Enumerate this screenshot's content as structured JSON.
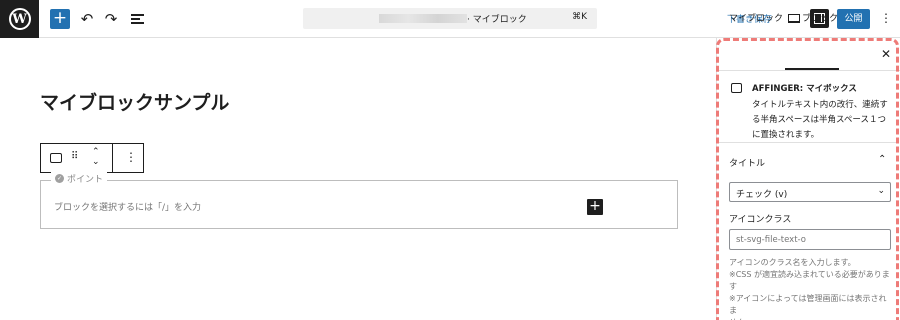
{
  "toolbar": {
    "logo": "W",
    "logo_icon": "wordpress-icon",
    "inserter_label": "+",
    "undo_icon": "↶",
    "redo_icon": "↷",
    "command_title": "· マイブロック",
    "command_shortcut": "⌘K",
    "save_draft": "下書き保存",
    "publish": "公開",
    "more": "⋮"
  },
  "editor": {
    "post_title": "マイブロックサンプル",
    "block_toolbar": {
      "drag": "⠿",
      "move_up": "⌃",
      "move_down": "⌄",
      "more": "⋮"
    },
    "point_label": "ポイント",
    "point_check": "✓",
    "appender_text": "ブロックを選択するには「/」を入力",
    "add_block": "+"
  },
  "sidebar": {
    "tabs": [
      "マイブロック",
      "ブロック"
    ],
    "active_tab": 1,
    "close": "✕",
    "card": {
      "title": "AFFINGER: マイボックス",
      "description": "タイトルテキスト内の改行、連続する半角スペースは半角スペース１つに置換されます。"
    },
    "panel": {
      "title": "タイトル",
      "chevron": "⌃",
      "select_value": "チェック (v)",
      "select_chevron": "⌄",
      "icon_class_label": "アイコンクラス",
      "icon_class_placeholder": "st-svg-file-text-o",
      "help_lines": [
        "アイコンのクラス名を入力します。",
        "※CSS が適宜読み込まれている必要がありま",
        "す",
        "※アイコンによっては管理画面には表示されま",
        "せん"
      ]
    }
  },
  "colors": {
    "accent": "#2271b1",
    "highlight_dash": "#ee7b78",
    "dark": "#1e1e1e"
  }
}
